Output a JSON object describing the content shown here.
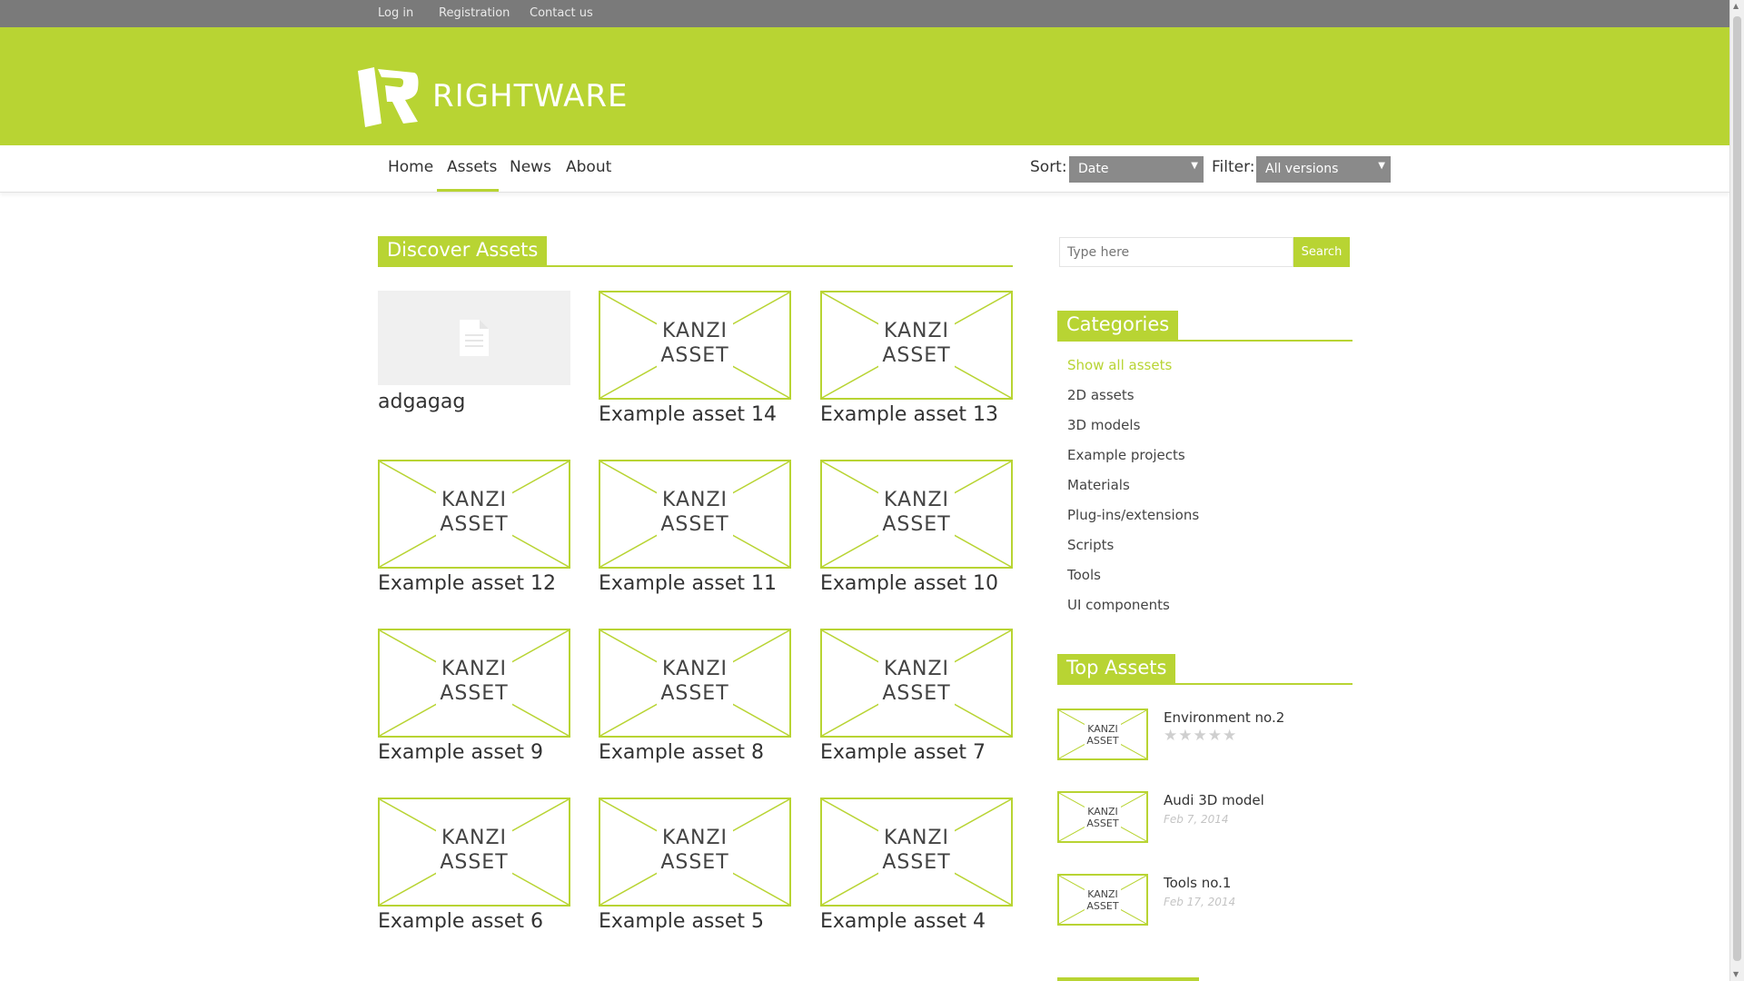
{
  "topbar": {
    "links": [
      "Log in",
      "Registration",
      "Contact us"
    ]
  },
  "header": {
    "brand": "RIGHTWARE"
  },
  "nav": {
    "items": [
      "Home",
      "Assets",
      "News",
      "About"
    ],
    "active": "Assets",
    "sort_label": "Sort:",
    "sort_value": "Date",
    "filter_label": "Filter:",
    "filter_value": "All versions"
  },
  "main": {
    "heading": "Discover Assets",
    "thumb_line1": "KANZI",
    "thumb_line2": "ASSET",
    "assets": [
      "adgagag",
      "Example asset 14",
      "Example asset 13",
      "Example asset 12",
      "Example asset 11",
      "Example asset 10",
      "Example asset 9",
      "Example asset 8",
      "Example asset 7",
      "Example asset 6",
      "Example asset 5",
      "Example asset 4"
    ]
  },
  "sidebar": {
    "search_placeholder": "Type here",
    "search_button": "Search",
    "categories_heading": "Categories",
    "categories": [
      "Show all assets",
      "2D assets",
      "3D models",
      "Example projects",
      "Materials",
      "Plug-ins/extensions",
      "Scripts",
      "Tools",
      "UI components"
    ],
    "top_heading": "Top Assets",
    "top_assets": [
      {
        "title": "Environment no.2",
        "rating": 0,
        "date": ""
      },
      {
        "title": "Audi 3D model",
        "date": "Feb 7, 2014"
      },
      {
        "title": "Tools no.1",
        "date": "Feb 17, 2014"
      }
    ]
  },
  "colors": {
    "accent": "#b8d433",
    "topbar": "#7a7a7a",
    "select_bg": "#8a8a8a"
  }
}
